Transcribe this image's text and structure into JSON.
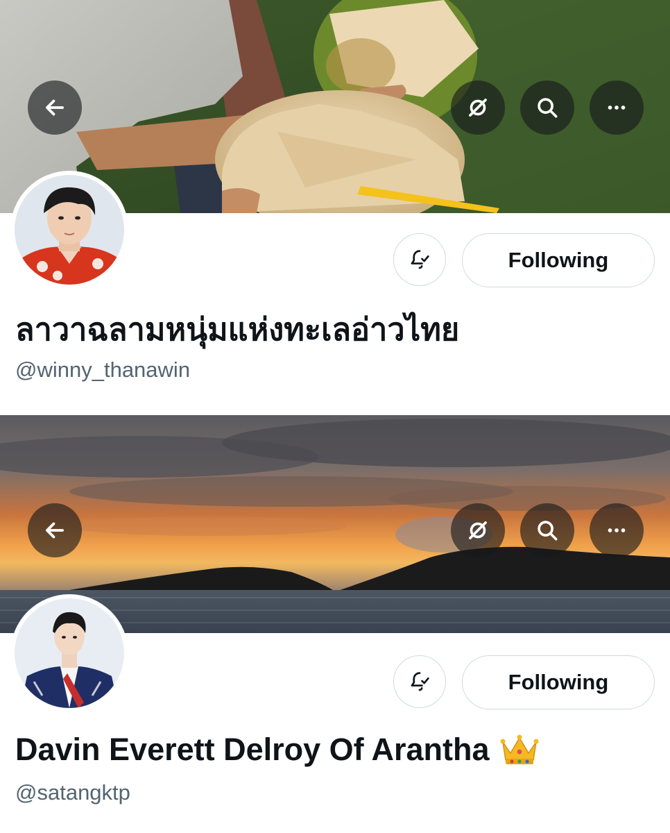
{
  "profiles": [
    {
      "display_name": "ลาวาฉลามหนุ่มแห่งทะเลอ่าวไทย",
      "handle": "@winny_thanawin",
      "follow_label": "Following",
      "banner_scene": "coconut drink held in hand over grass",
      "icons": [
        "back-arrow-icon",
        "hidden-eye-icon",
        "search-icon",
        "more-icon",
        "bell-check-icon"
      ]
    },
    {
      "display_name": "Davin Everett Delroy Of Arantha",
      "name_emoji": "crown",
      "handle": "@satangktp",
      "follow_label": "Following",
      "banner_scene": "sunset over sea and islands",
      "icons": [
        "back-arrow-icon",
        "hidden-eye-icon",
        "search-icon",
        "more-icon",
        "bell-check-icon"
      ]
    }
  ],
  "colors": {
    "handle_gray": "#536471",
    "button_border": "#cfd9de",
    "overlay_button": "#16181c"
  }
}
